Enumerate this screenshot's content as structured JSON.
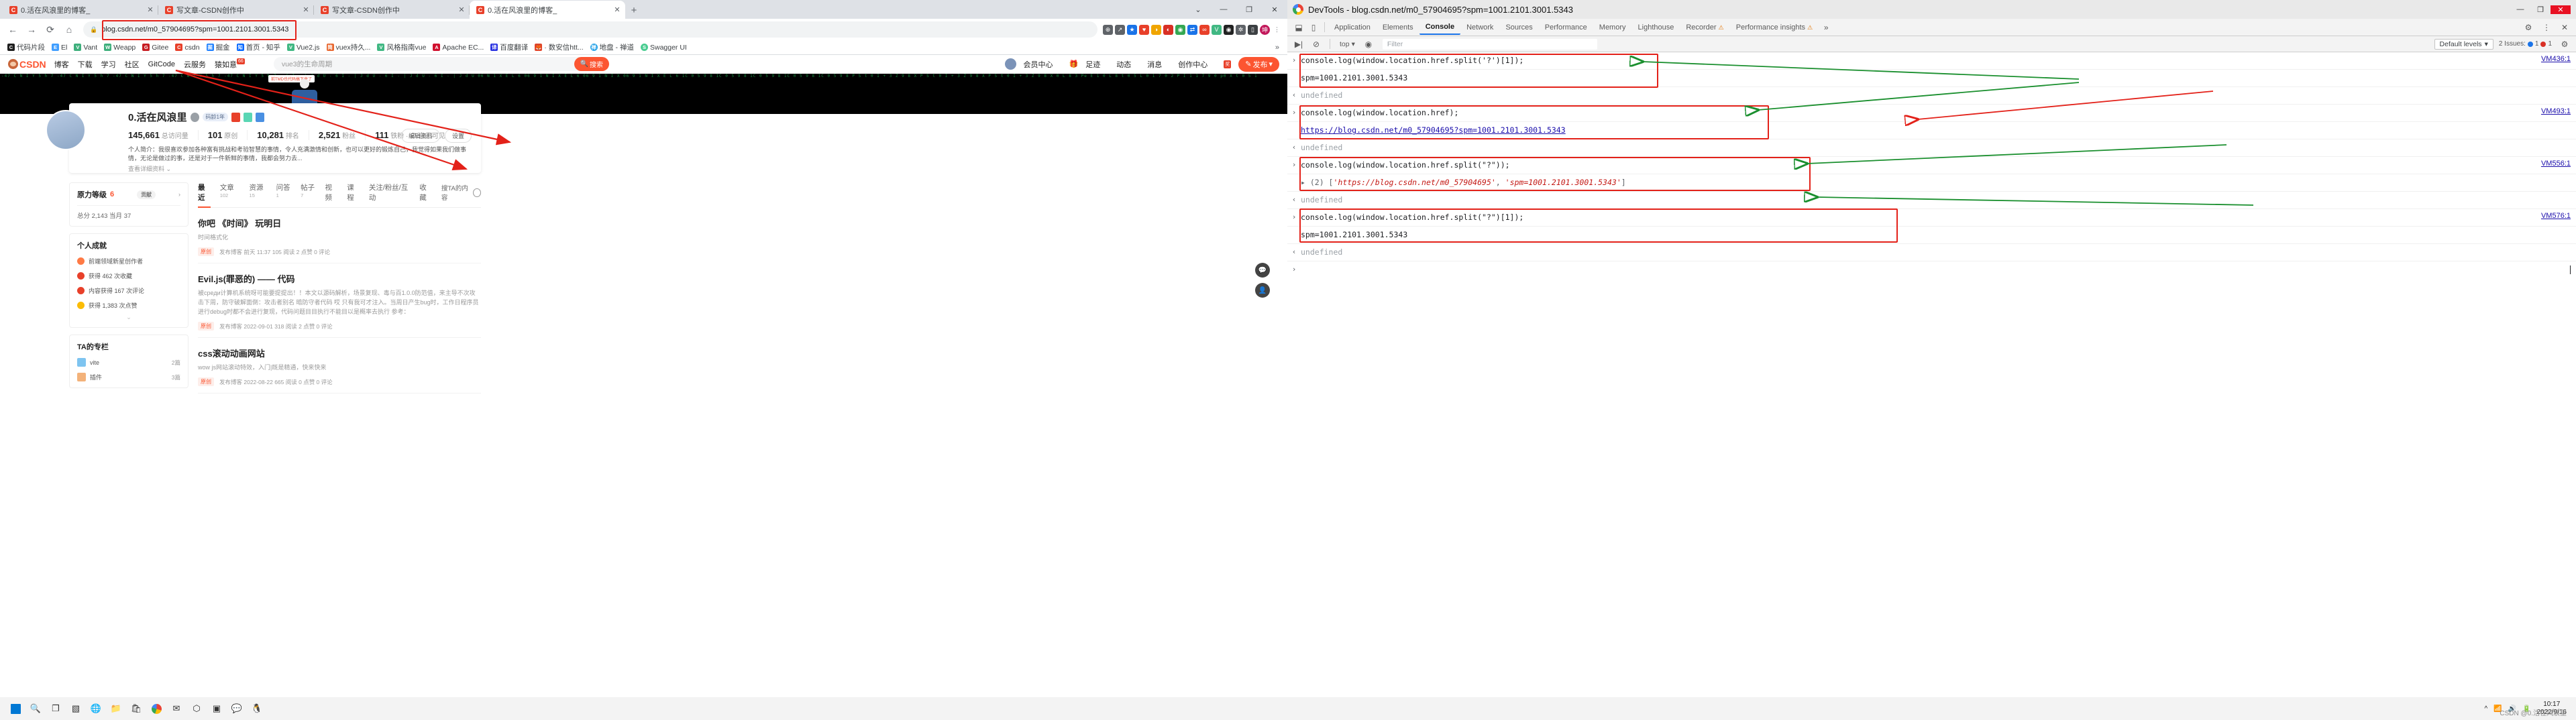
{
  "browser": {
    "tabs": [
      {
        "label": "0.活在风浪里的博客_",
        "active": false,
        "favicon": "C"
      },
      {
        "label": "写文章-CSDN创作中",
        "active": false,
        "favicon": "C"
      },
      {
        "label": "写文章-CSDN创作中",
        "active": false,
        "favicon": "C"
      },
      {
        "label": "0.活在风浪里的博客_",
        "active": true,
        "favicon": "C"
      }
    ],
    "new_tab_label": "+",
    "window_controls": [
      "⌄",
      "—",
      "❐",
      "✕"
    ],
    "nav": {
      "back": "←",
      "forward": "→",
      "reload": "⟳",
      "home": "⌂",
      "lock_icon": "lock",
      "url": "blog.csdn.net/m0_57904695?spm=1001.2101.3001.5343"
    },
    "extensions": [
      "⊕",
      "↗",
      "★",
      "♥",
      "⬒",
      "◐",
      "◑",
      "⇄",
      "∞",
      "V",
      "◉",
      "✲",
      "▯",
      "坤",
      "⋮"
    ],
    "bookmarks": [
      {
        "label": "代码片段",
        "color": "#1f1f1f"
      },
      {
        "label": "El",
        "color": "#409eff"
      },
      {
        "label": "Vant",
        "color": "#3eaf7c"
      },
      {
        "label": "Weapp",
        "color": "#3eaf7c"
      },
      {
        "label": "Gitee",
        "color": "#c71d23"
      },
      {
        "label": "csdn",
        "color": "#e8402a"
      },
      {
        "label": "掘金",
        "color": "#1e80ff"
      },
      {
        "label": "首页 - 知乎",
        "color": "#0066ff"
      },
      {
        "label": "Vue2.js",
        "color": "#41b883"
      },
      {
        "label": "vuex持久...",
        "color": "#e8672f"
      },
      {
        "label": "风格指南vue",
        "color": "#41b883"
      },
      {
        "label": "Apache EC...",
        "color": "#d0102e"
      },
      {
        "label": "百度翻译",
        "color": "#2932e1"
      },
      {
        "label": "· 数安信htt...",
        "color": "#e24329"
      },
      {
        "label": "地盘 - 禅道",
        "color": "#2ba4e8"
      },
      {
        "label": "Swagger UI",
        "color": "#49cc90"
      }
    ],
    "bookmarks_overflow": "»"
  },
  "csdn": {
    "logo_text": "CSDN",
    "nav_links": [
      "博客",
      "下载",
      "学习",
      "社区",
      "GitCode",
      "云服务",
      "猿如意"
    ],
    "nav_badge": "66",
    "search_placeholder": "vue3的生命周期",
    "search_button": "搜索",
    "user_links": [
      "会员中心",
      "足迹",
      "动态",
      "消息",
      "创作中心"
    ],
    "creator_badge": "奖",
    "publish_button": "发布",
    "hero_tip": "前TMD也代码搞下来了",
    "profile": {
      "name": "0.活在风浪里",
      "chip": "码龄1年",
      "stats": [
        {
          "value": "145,661",
          "label": "总访问量"
        },
        {
          "value": "101",
          "label": "原创"
        },
        {
          "value": "10,281",
          "label": "排名"
        },
        {
          "value": "2,521",
          "label": "粉丝"
        },
        {
          "value": "111",
          "label": "铁粉 · ⊘ 自己可见"
        }
      ],
      "bio": "个人简介：我很喜欢参加各种富有挑战和考验智慧的事情，令人充满激情和创新，也可以更好的锻炼自己，我觉得如果我们做事情，无论是做过的事，还是对于一件新鲜的事情，我都会努力去...",
      "more": "查看详细资料 ⌄",
      "buttons": [
        "编辑资料",
        "设置"
      ]
    },
    "left_cards": [
      {
        "title": "原力等级",
        "badge": "6",
        "pill": "贡献",
        "more": "›",
        "rows": [
          {
            "text": "总分 2,143  当月 37"
          }
        ]
      },
      {
        "title": "个人成就",
        "achievements": [
          {
            "label": "前端领域新星创作者",
            "color": "#ff7a45"
          },
          {
            "label": "获得 462 次收藏",
            "color": "#e8402a"
          },
          {
            "label": "内容获得 167 次评论",
            "color": "#e8402a"
          },
          {
            "label": "获得 1,383 次点赞",
            "color": "#fbbc05"
          }
        ],
        "expand": "⌄"
      },
      {
        "title": "TA的专栏",
        "columns": [
          {
            "name": "vite",
            "sub": "vite",
            "count": "2篇"
          },
          {
            "name": "插件",
            "sub": "插件",
            "count": "3篇"
          }
        ]
      }
    ],
    "main": {
      "tabs": [
        {
          "label": "最近",
          "count": "",
          "active": true
        },
        {
          "label": "文章",
          "count": "102",
          "active": false
        },
        {
          "label": "资源",
          "count": "15",
          "active": false
        },
        {
          "label": "问答",
          "count": "1",
          "active": false
        },
        {
          "label": "帖子",
          "count": "7",
          "active": false
        },
        {
          "label": "视频",
          "count": "",
          "active": false
        },
        {
          "label": "课程",
          "count": "",
          "active": false
        },
        {
          "label": "关注/粉丝/互动",
          "count": "",
          "active": false
        },
        {
          "label": "收藏",
          "count": "",
          "active": false
        }
      ],
      "search_in_tab": "搜TA的内容",
      "articles": [
        {
          "title": "你吧 《时间》 玩明日",
          "subtitle": "时间格式化",
          "tag": "原创",
          "meta": "发布博客 前天 11:37    105 阅读    2 点赞    0 评论"
        },
        {
          "title": "Evil.js(罪恶的) —— 代码",
          "subtitle": "被среди计算机系统呀可能要提提出！！本文以源码解析，场景复现、毒与百1.0.0防范值，来主导不次攻击下周，防守破解面倒：攻击者别名 暗防守者代码 哎 只有我可才注入。当周日产生bug时，工作日程序员进行debug时都不会进行复现，代码问题目目执行不能目以是概率去执行 参考：",
          "tag": "原创",
          "meta": "发布博客 2022-09-01    318 阅读    2 点赞    0 评论"
        },
        {
          "title": "css滚动动画网站",
          "subtitle": "wow js网站滚动特效，入门|既是精通，快来快来",
          "tag": "原创",
          "meta": "发布博客 2022-08-22    665 阅读    0 点赞    0 评论"
        }
      ]
    }
  },
  "devtools": {
    "window_title": "DevTools - blog.csdn.net/m0_57904695?spm=1001.2101.3001.5343",
    "window_controls": [
      "—",
      "❐",
      "✕"
    ],
    "toolbar_icons": [
      "inspect-icon",
      "device-toolbar-icon"
    ],
    "tabs": [
      {
        "label": "Application",
        "active": false
      },
      {
        "label": "Elements",
        "active": false
      },
      {
        "label": "Console",
        "active": true
      },
      {
        "label": "Network",
        "active": false
      },
      {
        "label": "Sources",
        "active": false
      },
      {
        "label": "Performance",
        "active": false
      },
      {
        "label": "Memory",
        "active": false
      },
      {
        "label": "Lighthouse",
        "active": false
      },
      {
        "label": "Recorder",
        "active": false,
        "warn": "⚠"
      },
      {
        "label": "Performance insights",
        "active": false,
        "warn": "⚠"
      }
    ],
    "tab_overflow": "»",
    "settings_icon": "gear-icon",
    "more_icon": "kebab-menu-icon",
    "close_panel_icon": "close-icon",
    "filterbar": {
      "execute_icon": "execute-icon",
      "clear_icon": "clear-console-icon",
      "context": "top",
      "eye_icon": "live-expression-icon",
      "filter_placeholder": "Filter",
      "levels": "Default levels",
      "issues_text": "2 Issues:",
      "issues_blue": "1",
      "issues_red": "1",
      "settings": "gear-icon"
    },
    "console_entries": [
      {
        "type": "input",
        "gutter": "›",
        "text": "console.log(window.location.href.split('?')[1]);",
        "vm": "VM436:1",
        "boxed": true
      },
      {
        "type": "output",
        "gutter": "",
        "text": "spm=1001.2101.3001.5343",
        "vm": "",
        "boxed": true
      },
      {
        "type": "return",
        "gutter": "‹",
        "text": "undefined",
        "vm": "",
        "dim": true
      },
      {
        "type": "input",
        "gutter": "›",
        "text": "console.log(window.location.href);",
        "vm": "VM493:1",
        "boxed": true
      },
      {
        "type": "output-link",
        "gutter": "",
        "text": "https://blog.csdn.net/m0_57904695?spm=1001.2101.3001.5343",
        "vm": "",
        "boxed": true
      },
      {
        "type": "return",
        "gutter": "‹",
        "text": "undefined",
        "vm": "",
        "dim": true
      },
      {
        "type": "input",
        "gutter": "›",
        "text": "console.log(window.location.href.split(\"?\"));",
        "vm": "VM556:1",
        "boxed": true
      },
      {
        "type": "output-array",
        "gutter": "",
        "prefix": "▸ (2) [",
        "item1": "'https://blog.csdn.net/m0_57904695'",
        "sep": ", ",
        "item2": "'spm=1001.2101.3001.5343'",
        "suffix": "]",
        "vm": "",
        "boxed": true
      },
      {
        "type": "return",
        "gutter": "‹",
        "text": "undefined",
        "vm": "",
        "dim": true
      },
      {
        "type": "input",
        "gutter": "›",
        "text": "console.log(window.location.href.split(\"?\")[1]);",
        "vm": "VM576:1",
        "boxed": true
      },
      {
        "type": "output",
        "gutter": "",
        "text": "spm=1001.2101.3001.5343",
        "vm": "",
        "boxed": true
      },
      {
        "type": "return",
        "gutter": "‹",
        "text": "undefined",
        "vm": "",
        "dim": true
      },
      {
        "type": "prompt",
        "gutter": "›",
        "text": "",
        "vm": ""
      }
    ],
    "annotation_color_red": "#e32119",
    "annotation_color_green": "#1a8f2e"
  },
  "taskbar": {
    "icons": [
      "start-icon",
      "search-icon",
      "task-view-icon",
      "widgets-icon",
      "edge-icon",
      "folder-icon",
      "store-icon",
      "chrome-icon",
      "mail-icon",
      "vscode-icon",
      "terminal-icon",
      "wechat-icon",
      "qq-icon"
    ],
    "tray": [
      "^",
      "wifi-icon",
      "volume-icon",
      "battery-icon"
    ],
    "clock_time": "10:17",
    "clock_date": "2022/9/16",
    "watermark": "CSDN @0.活在风浪里"
  }
}
